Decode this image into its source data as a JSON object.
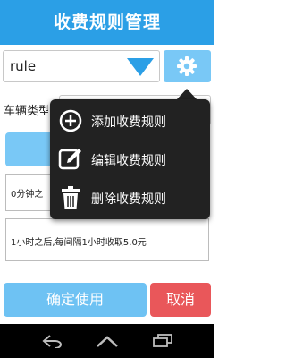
{
  "header": {
    "title": "收费规则管理"
  },
  "rule_selector": {
    "value": "rule"
  },
  "vehicle_type": {
    "label": "车辆类型"
  },
  "rules": [
    {
      "text": "0分钟之"
    },
    {
      "text": "1小时之后,每间隔1小时收取5.0元"
    }
  ],
  "actions": {
    "confirm_label": "确定使用",
    "cancel_label": "取消"
  },
  "popup_menu": {
    "items": [
      {
        "label": "添加收费规则",
        "icon": "add-circle-icon"
      },
      {
        "label": "编辑收费规则",
        "icon": "edit-icon"
      },
      {
        "label": "删除收费规则",
        "icon": "trash-icon"
      }
    ]
  },
  "colors": {
    "primary": "#2b9fe6",
    "light_blue": "#79c8f6",
    "cancel_red": "#e9575a",
    "popup_bg": "#222222"
  }
}
